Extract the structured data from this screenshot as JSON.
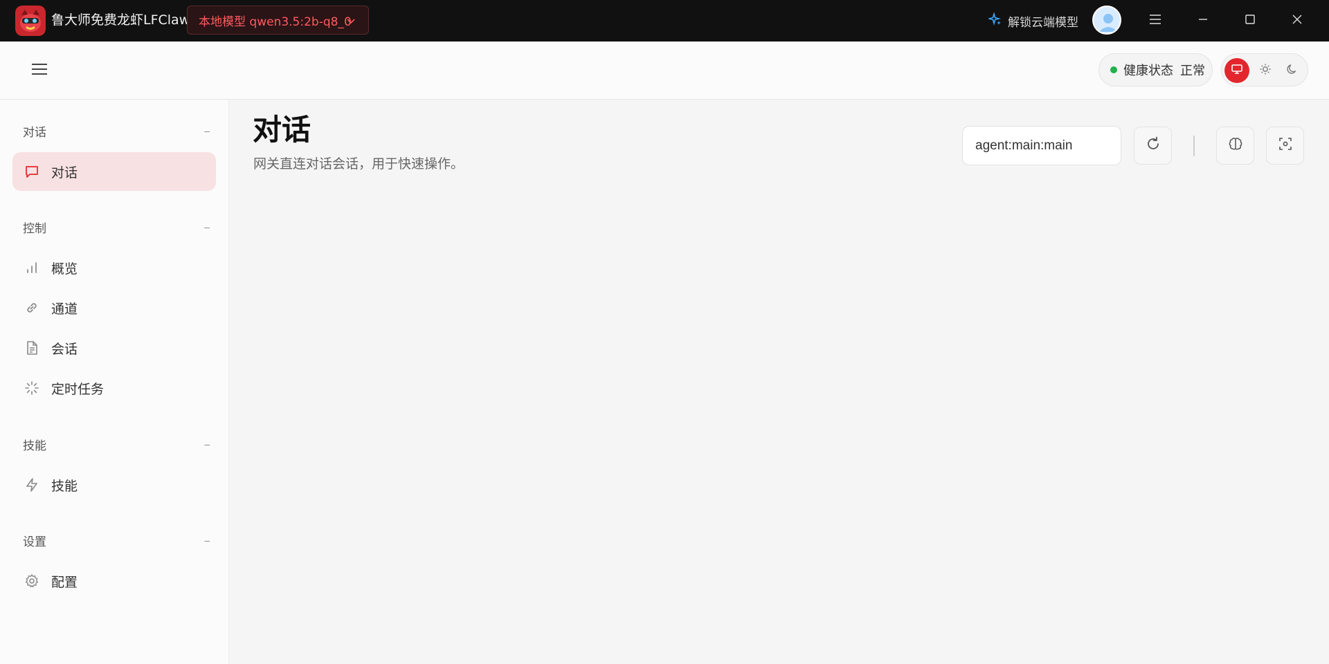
{
  "titlebar": {
    "app_title": "鲁大师免费龙虾LFClaw",
    "model_label": "本地模型 qwen3.5:2b-q8_0",
    "unlock_cloud_label": "解锁云端模型"
  },
  "header": {
    "health_label": "健康状态",
    "health_value": "正常"
  },
  "sidebar": {
    "sections": [
      {
        "title": "对话",
        "items": [
          {
            "label": "对话",
            "icon": "chat-bubble-icon",
            "active": true
          }
        ]
      },
      {
        "title": "控制",
        "items": [
          {
            "label": "概览",
            "icon": "bar-chart-icon"
          },
          {
            "label": "通道",
            "icon": "link-icon"
          },
          {
            "label": "会话",
            "icon": "document-icon"
          },
          {
            "label": "定时任务",
            "icon": "loader-icon"
          }
        ]
      },
      {
        "title": "技能",
        "items": [
          {
            "label": "技能",
            "icon": "lightning-icon"
          }
        ]
      },
      {
        "title": "设置",
        "items": [
          {
            "label": "配置",
            "icon": "gear-icon"
          }
        ]
      }
    ],
    "collapse_symbol": "–"
  },
  "main": {
    "title": "对话",
    "subtitle": "网关直连对话会话，用于快速操作。",
    "session_key": "agent:main:main"
  },
  "colors": {
    "accent": "#e3262d",
    "titlebar_bg": "#111111",
    "active_nav_bg": "#f8e1e2",
    "health_ok": "#22b14c"
  }
}
